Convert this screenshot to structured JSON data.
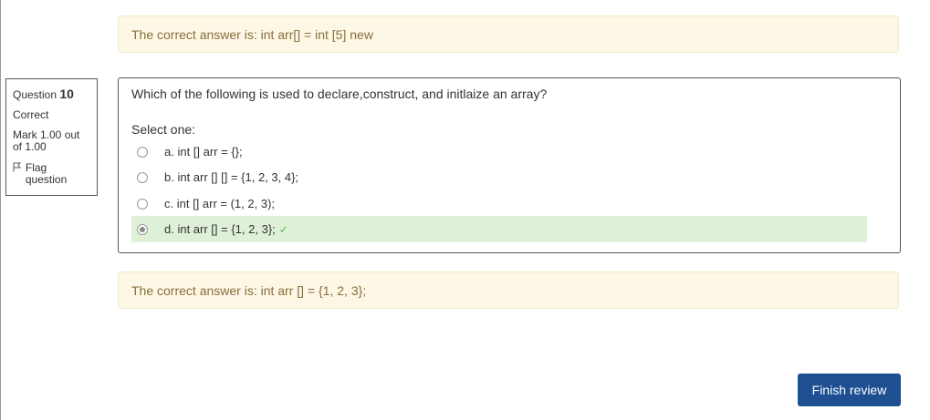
{
  "feedback_top": "The correct answer is: int arr[] = int [5] new",
  "info": {
    "question_prefix": "Question",
    "question_number": "10",
    "state": "Correct",
    "grade": "Mark 1.00 out of 1.00",
    "flag_label": "Flag question"
  },
  "question": {
    "text": "Which of the following is used to declare,construct, and initlaize an array?",
    "prompt": "Select one:",
    "options": [
      {
        "label": "a. int [] arr = {};"
      },
      {
        "label": "b. int arr [] [] = {1, 2, 3, 4};"
      },
      {
        "label": "c. int [] arr = (1, 2, 3);"
      },
      {
        "label": "d. int arr [] = {1, 2, 3};"
      }
    ],
    "check_mark": "✓"
  },
  "feedback_bottom": "The correct answer is: int arr [] = {1, 2, 3};",
  "finish_button": "Finish review",
  "colors": {
    "feedback_bg": "#fdf8e6",
    "correct_bg": "#dff0d8",
    "button_bg": "#1d4f91",
    "check": "#5cb85c"
  }
}
